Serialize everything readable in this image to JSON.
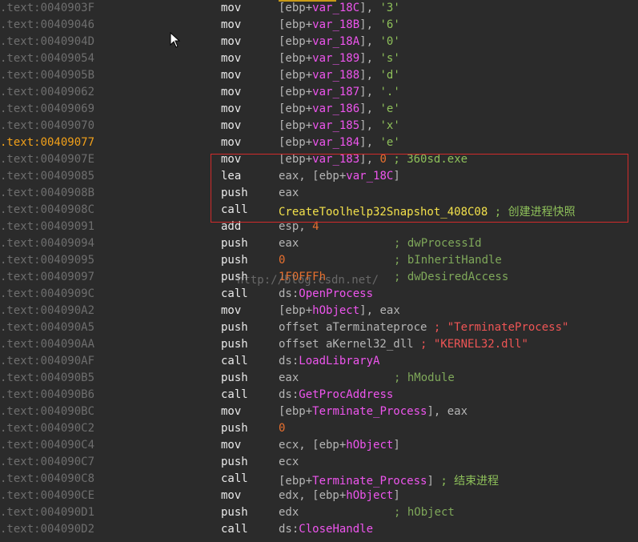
{
  "topbar_color": "#c99a17",
  "lines": [
    {
      "addr": ".text:0040903F",
      "mn": "mov",
      "ops": [
        {
          "t": "[ebp+"
        },
        {
          "t": "var_18C",
          "c": "var"
        },
        {
          "t": "], "
        },
        {
          "t": "'3'",
          "c": "str"
        }
      ]
    },
    {
      "addr": ".text:00409046",
      "mn": "mov",
      "ops": [
        {
          "t": "[ebp+"
        },
        {
          "t": "var_18B",
          "c": "var"
        },
        {
          "t": "], "
        },
        {
          "t": "'6'",
          "c": "str"
        }
      ]
    },
    {
      "addr": ".text:0040904D",
      "mn": "mov",
      "ops": [
        {
          "t": "[ebp+"
        },
        {
          "t": "var_18A",
          "c": "var"
        },
        {
          "t": "], "
        },
        {
          "t": "'0'",
          "c": "str"
        }
      ]
    },
    {
      "addr": ".text:00409054",
      "mn": "mov",
      "ops": [
        {
          "t": "[ebp+"
        },
        {
          "t": "var_189",
          "c": "var"
        },
        {
          "t": "], "
        },
        {
          "t": "'s'",
          "c": "str"
        }
      ]
    },
    {
      "addr": ".text:0040905B",
      "mn": "mov",
      "ops": [
        {
          "t": "[ebp+"
        },
        {
          "t": "var_188",
          "c": "var"
        },
        {
          "t": "], "
        },
        {
          "t": "'d'",
          "c": "str"
        }
      ]
    },
    {
      "addr": ".text:00409062",
      "mn": "mov",
      "ops": [
        {
          "t": "[ebp+"
        },
        {
          "t": "var_187",
          "c": "var"
        },
        {
          "t": "], "
        },
        {
          "t": "'.'",
          "c": "str"
        }
      ]
    },
    {
      "addr": ".text:00409069",
      "mn": "mov",
      "ops": [
        {
          "t": "[ebp+"
        },
        {
          "t": "var_186",
          "c": "var"
        },
        {
          "t": "], "
        },
        {
          "t": "'e'",
          "c": "str"
        }
      ]
    },
    {
      "addr": ".text:00409070",
      "mn": "mov",
      "ops": [
        {
          "t": "[ebp+"
        },
        {
          "t": "var_185",
          "c": "var"
        },
        {
          "t": "], "
        },
        {
          "t": "'x'",
          "c": "str"
        }
      ]
    },
    {
      "addr": ".text:00409077",
      "mn": "mov",
      "current": true,
      "ops": [
        {
          "t": "[ebp+"
        },
        {
          "t": "var_184",
          "c": "var"
        },
        {
          "t": "], "
        },
        {
          "t": "'e'",
          "c": "str"
        }
      ]
    },
    {
      "addr": ".text:0040907E",
      "mn": "mov",
      "ops": [
        {
          "t": "[ebp+"
        },
        {
          "t": "var_183",
          "c": "var"
        },
        {
          "t": "], "
        },
        {
          "t": "0",
          "c": "num"
        },
        {
          "t": " ; 360sd.exe",
          "c": "str"
        }
      ]
    },
    {
      "addr": ".text:00409085",
      "mn": "lea",
      "ops": [
        {
          "t": "eax, [ebp+"
        },
        {
          "t": "var_18C",
          "c": "var"
        },
        {
          "t": "]"
        }
      ]
    },
    {
      "addr": ".text:0040908B",
      "mn": "push",
      "ops": [
        {
          "t": "eax"
        }
      ]
    },
    {
      "addr": ".text:0040908C",
      "mn": "call",
      "ops": [
        {
          "t": "CreateToolhelp32Snapshot_408C08",
          "c": "func"
        },
        {
          "t": " ; 创建进程快照",
          "c": "str"
        }
      ]
    },
    {
      "addr": ".text:00409091",
      "mn": "add",
      "ops": [
        {
          "t": "esp, "
        },
        {
          "t": "4",
          "c": "num"
        }
      ]
    },
    {
      "addr": ".text:00409094",
      "mn": "push",
      "ops": [
        {
          "t": "eax"
        }
      ],
      "cmt": "; dwProcessId"
    },
    {
      "addr": ".text:00409095",
      "mn": "push",
      "ops": [
        {
          "t": "0",
          "c": "num"
        }
      ],
      "cmt": "; bInheritHandle"
    },
    {
      "addr": ".text:00409097",
      "mn": "push",
      "ops": [
        {
          "t": "1F0FFFh",
          "c": "num"
        }
      ],
      "cmt": "; dwDesiredAccess"
    },
    {
      "addr": ".text:0040909C",
      "mn": "call",
      "ops": [
        {
          "t": "ds:"
        },
        {
          "t": "OpenProcess",
          "c": "name"
        }
      ]
    },
    {
      "addr": ".text:004090A2",
      "mn": "mov",
      "ops": [
        {
          "t": "[ebp+"
        },
        {
          "t": "hObject",
          "c": "var"
        },
        {
          "t": "], eax"
        }
      ]
    },
    {
      "addr": ".text:004090A5",
      "mn": "push",
      "ops": [
        {
          "t": "offset aTerminateproce "
        },
        {
          "t": "; \"TerminateProcess\"",
          "c": "strc"
        }
      ]
    },
    {
      "addr": ".text:004090AA",
      "mn": "push",
      "ops": [
        {
          "t": "offset aKernel32_dll "
        },
        {
          "t": "; \"KERNEL32.dll\"",
          "c": "strc"
        }
      ]
    },
    {
      "addr": ".text:004090AF",
      "mn": "call",
      "ops": [
        {
          "t": "ds:"
        },
        {
          "t": "LoadLibraryA",
          "c": "name"
        }
      ]
    },
    {
      "addr": ".text:004090B5",
      "mn": "push",
      "ops": [
        {
          "t": "eax"
        }
      ],
      "cmt": "; hModule"
    },
    {
      "addr": ".text:004090B6",
      "mn": "call",
      "ops": [
        {
          "t": "ds:"
        },
        {
          "t": "GetProcAddress",
          "c": "name"
        }
      ]
    },
    {
      "addr": ".text:004090BC",
      "mn": "mov",
      "ops": [
        {
          "t": "[ebp+"
        },
        {
          "t": "Terminate_Process",
          "c": "var"
        },
        {
          "t": "], eax"
        }
      ]
    },
    {
      "addr": ".text:004090C2",
      "mn": "push",
      "ops": [
        {
          "t": "0",
          "c": "num"
        }
      ]
    },
    {
      "addr": ".text:004090C4",
      "mn": "mov",
      "ops": [
        {
          "t": "ecx, [ebp+"
        },
        {
          "t": "hObject",
          "c": "var"
        },
        {
          "t": "]"
        }
      ]
    },
    {
      "addr": ".text:004090C7",
      "mn": "push",
      "ops": [
        {
          "t": "ecx"
        }
      ]
    },
    {
      "addr": ".text:004090C8",
      "mn": "call",
      "ops": [
        {
          "t": "[ebp+"
        },
        {
          "t": "Terminate_Process",
          "c": "var"
        },
        {
          "t": "] "
        },
        {
          "t": "; 结束进程",
          "c": "str"
        }
      ]
    },
    {
      "addr": ".text:004090CE",
      "mn": "mov",
      "ops": [
        {
          "t": "edx, [ebp+"
        },
        {
          "t": "hObject",
          "c": "var"
        },
        {
          "t": "]"
        }
      ]
    },
    {
      "addr": ".text:004090D1",
      "mn": "push",
      "ops": [
        {
          "t": "edx"
        }
      ],
      "cmt": "; hObject"
    },
    {
      "addr": ".text:004090D2",
      "mn": "call",
      "ops": [
        {
          "t": "ds:"
        },
        {
          "t": "CloseHandle",
          "c": "name"
        }
      ]
    }
  ],
  "watermark": "http://blog.csdn.net/"
}
